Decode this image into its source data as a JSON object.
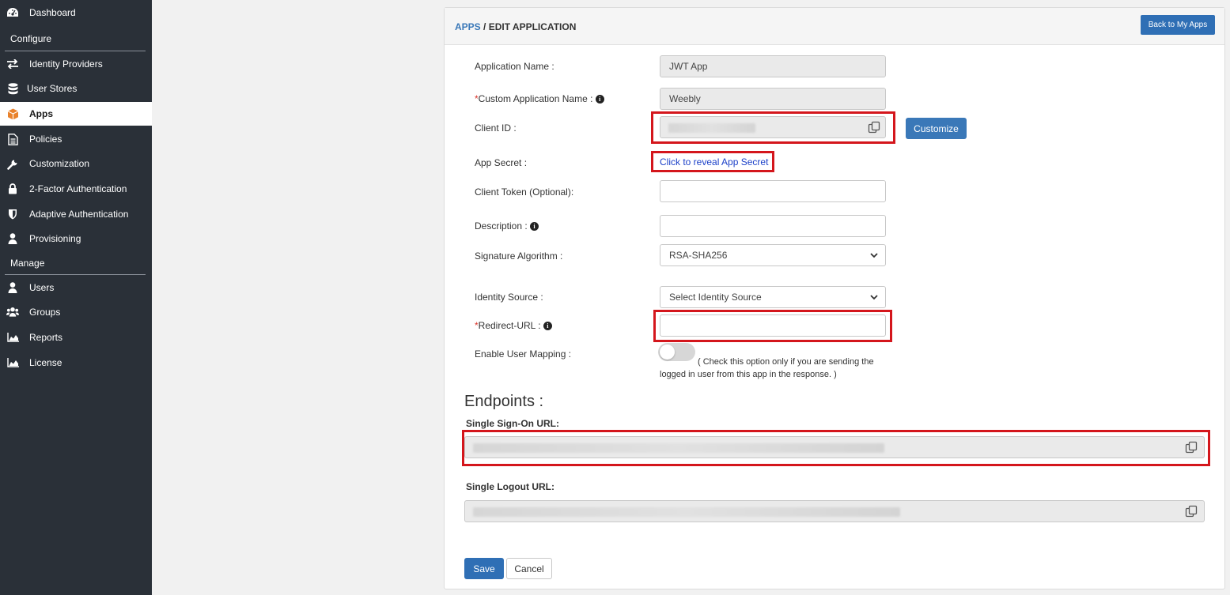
{
  "sidebar": {
    "items": [
      {
        "label": "Dashboard",
        "icon": "dashboard-icon"
      },
      {
        "label": "Identity Providers",
        "icon": "exchange-icon"
      },
      {
        "label": "User Stores",
        "icon": "database-icon"
      },
      {
        "label": "Apps",
        "icon": "cube-icon",
        "active": true
      },
      {
        "label": "Policies",
        "icon": "file-icon"
      },
      {
        "label": "Customization",
        "icon": "wrench-icon"
      },
      {
        "label": "2-Factor Authentication",
        "icon": "lock-icon"
      },
      {
        "label": "Adaptive Authentication",
        "icon": "shield-icon"
      },
      {
        "label": "Provisioning",
        "icon": "user-icon"
      },
      {
        "label": "Users",
        "icon": "user-icon"
      },
      {
        "label": "Groups",
        "icon": "users-icon"
      },
      {
        "label": "Reports",
        "icon": "area-chart-icon"
      },
      {
        "label": "License",
        "icon": "area-chart-icon"
      }
    ],
    "sections": {
      "configure": "Configure",
      "manage": "Manage"
    }
  },
  "header": {
    "breadcrumb_apps": "APPS",
    "breadcrumb_sep": " / ",
    "breadcrumb_page": "EDIT APPLICATION",
    "back_button": "Back to My Apps"
  },
  "form": {
    "app_name_label": "Application Name :",
    "app_name_value": "JWT App",
    "custom_name_required": "*",
    "custom_name_label": "Custom Application Name : ",
    "custom_name_value": "Weebly",
    "client_id_label": "Client ID :",
    "customize_button": "Customize",
    "app_secret_label": "App Secret :",
    "reveal_link": "Click to reveal App Secret",
    "client_token_label": "Client Token (Optional):",
    "description_label": "Description : ",
    "sig_alg_label": "Signature Algorithm :",
    "sig_alg_value": "RSA-SHA256",
    "identity_source_label": "Identity Source :",
    "identity_source_value": "Select Identity Source",
    "redirect_required": "*",
    "redirect_label": "Redirect-URL : ",
    "user_mapping_label": "Enable User Mapping :",
    "user_mapping_enabled": false,
    "user_mapping_note": "( Check this option only if you are sending the logged in user from this app in the response. )"
  },
  "endpoints": {
    "title": "Endpoints :",
    "sso_label": "Single Sign-On URL:",
    "slo_label": "Single Logout URL:"
  },
  "actions": {
    "save": "Save",
    "cancel": "Cancel"
  },
  "colors": {
    "sidebar_bg": "#2a3038",
    "primary": "#2f6fb5",
    "highlight": "#d4161c",
    "link": "#1a3fc8"
  }
}
